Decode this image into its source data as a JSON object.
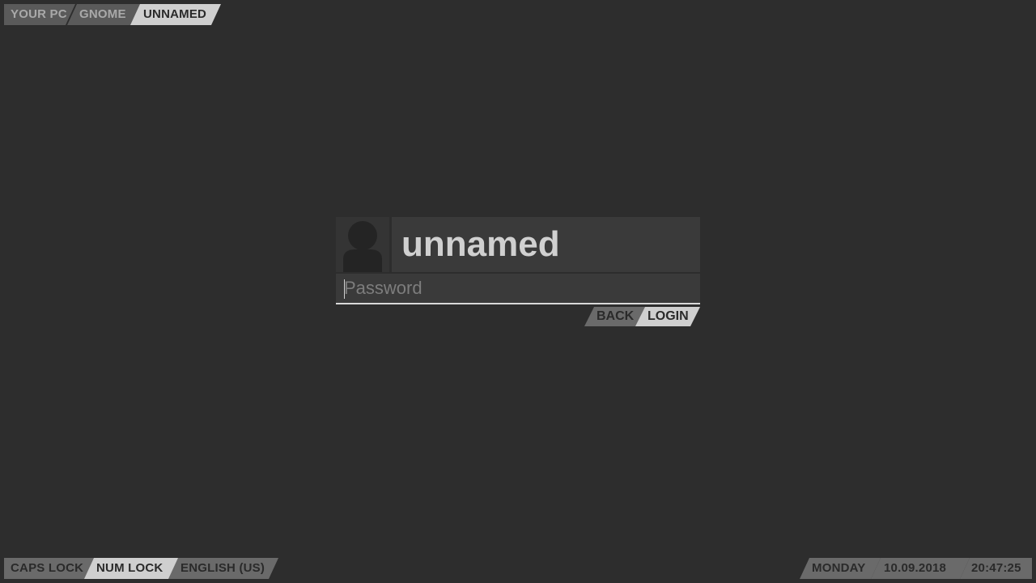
{
  "breadcrumb": {
    "items": [
      "YOUR PC",
      "GNOME",
      "UNNAMED"
    ]
  },
  "login": {
    "avatar_icon": "user-silhouette-icon",
    "username": "unnamed",
    "password_placeholder": "Password",
    "password_value": "",
    "back_label": "BACK",
    "login_label": "LOGIN"
  },
  "status": {
    "caps_lock": "CAPS LOCK",
    "num_lock": "NUM LOCK",
    "layout": "ENGLISH (US)"
  },
  "clock": {
    "day": "MONDAY",
    "date": "10.09.2018",
    "time": "20:47:25"
  },
  "colors": {
    "background": "#2d2d2d",
    "panel": "#3a3a3a",
    "accent_light": "#cfcfcf",
    "accent_mid": "#6a6a6a",
    "accent_dim": "#5a5a5a"
  }
}
